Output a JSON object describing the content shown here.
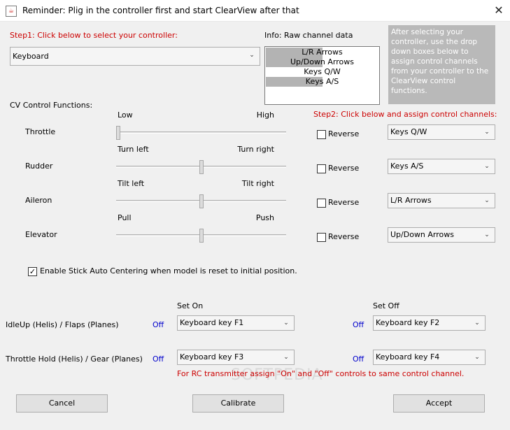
{
  "window": {
    "title": "Reminder: Plig in the controller first and start ClearView after that",
    "close_glyph": "✕",
    "app_icon_glyph": "☕"
  },
  "step1": {
    "label": "Step1: Click below to select your controller:",
    "controller": "Keyboard"
  },
  "raw_data": {
    "label": "Info: Raw channel data",
    "channels": [
      {
        "label": "L/R Arrows",
        "level": 0.5
      },
      {
        "label": "Up/Down Arrows",
        "level": 0.5
      },
      {
        "label": "Keys Q/W",
        "level": 0.0
      },
      {
        "label": "Keys A/S",
        "level": 0.5
      }
    ]
  },
  "info_text": "After selecting your controller, use the drop down boxes below to assign control channels from your controller to the ClearView control functions.",
  "cv_label": "CV Control Functions:",
  "step2_label": "Step2: Click below and assign control channels:",
  "functions": [
    {
      "name": "Throttle",
      "low": "Low",
      "high": "High",
      "value": 0.0,
      "reverse_label": "Reverse",
      "reverse": false,
      "channel": "Keys Q/W"
    },
    {
      "name": "Rudder",
      "low": "Turn left",
      "high": "Turn right",
      "value": 0.5,
      "reverse_label": "Reverse",
      "reverse": false,
      "channel": "Keys A/S"
    },
    {
      "name": "Aileron",
      "low": "Tilt left",
      "high": "Tilt right",
      "value": 0.5,
      "reverse_label": "Reverse",
      "reverse": false,
      "channel": "L/R Arrows"
    },
    {
      "name": "Elevator",
      "low": "Pull",
      "high": "Push",
      "value": 0.5,
      "reverse_label": "Reverse",
      "reverse": false,
      "channel": "Up/Down Arrows"
    }
  ],
  "auto_center": {
    "label": "Enable Stick Auto Centering when model is reset to initial position.",
    "checked": true,
    "check_glyph": "✓"
  },
  "switches": {
    "set_on_label": "Set On",
    "set_off_label": "Set Off",
    "rows": [
      {
        "name": "IdleUp (Helis) / Flaps (Planes)",
        "on_status": "Off",
        "on_key": "Keyboard key F1",
        "off_status": "Off",
        "off_key": "Keyboard key F2"
      },
      {
        "name": "Throttle Hold (Helis) / Gear (Planes)",
        "on_status": "Off",
        "on_key": "Keyboard key F3",
        "off_status": "Off",
        "off_key": "Keyboard key F4"
      }
    ],
    "note": "For RC transmitter assign \"On\" and \"Off\" controls to same control channel."
  },
  "buttons": {
    "cancel": "Cancel",
    "calibrate": "Calibrate",
    "accept": "Accept"
  },
  "dropdown_arrow_glyph": "⌄",
  "watermark": "SOFTPEDIA",
  "colors": {
    "step_label": "#cc0000",
    "status_off": "#0000cc",
    "info_panel": "#b9b9b9"
  }
}
